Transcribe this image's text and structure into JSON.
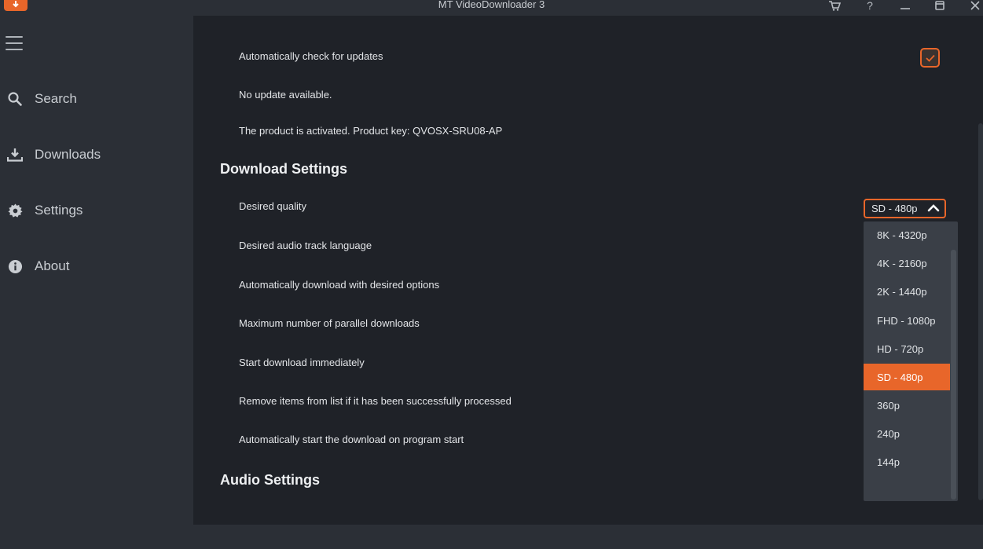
{
  "app": {
    "title": "MT VideoDownloader 3"
  },
  "titlebar": {
    "cart": "🛒",
    "help": "?",
    "minimize": "—",
    "maximize": "❐",
    "close": "✕"
  },
  "sidebar": {
    "items": [
      {
        "label": "Search",
        "icon": "search-icon"
      },
      {
        "label": "Downloads",
        "icon": "download-icon"
      },
      {
        "label": "Settings",
        "icon": "gear-icon"
      },
      {
        "label": "About",
        "icon": "info-icon"
      }
    ]
  },
  "settings": {
    "auto_update": {
      "label": "Automatically check for updates",
      "checked": true
    },
    "update_status": "No update available.",
    "activation": "The product is activated. Product key: QVOSX-SRU08-AP",
    "download_section": "Download Settings",
    "rows": [
      "Desired quality",
      "Desired audio track language",
      "Automatically download with desired options",
      "Maximum number of parallel downloads",
      "Start download immediately",
      "Remove items from list if it has been successfully processed",
      "Automatically start the download on program start"
    ],
    "audio_section": "Audio Settings",
    "quality_select": {
      "value": "SD - 480p",
      "options": [
        "8K - 4320p",
        "4K - 2160p",
        "2K - 1440p",
        "FHD - 1080p",
        "HD - 720p",
        "SD - 480p",
        "360p",
        "240p",
        "144p"
      ]
    }
  },
  "colors": {
    "accent": "#e8662a",
    "panel": "#1f2228",
    "sidebar": "#2b2f36",
    "dropdown": "#3a3f47"
  }
}
